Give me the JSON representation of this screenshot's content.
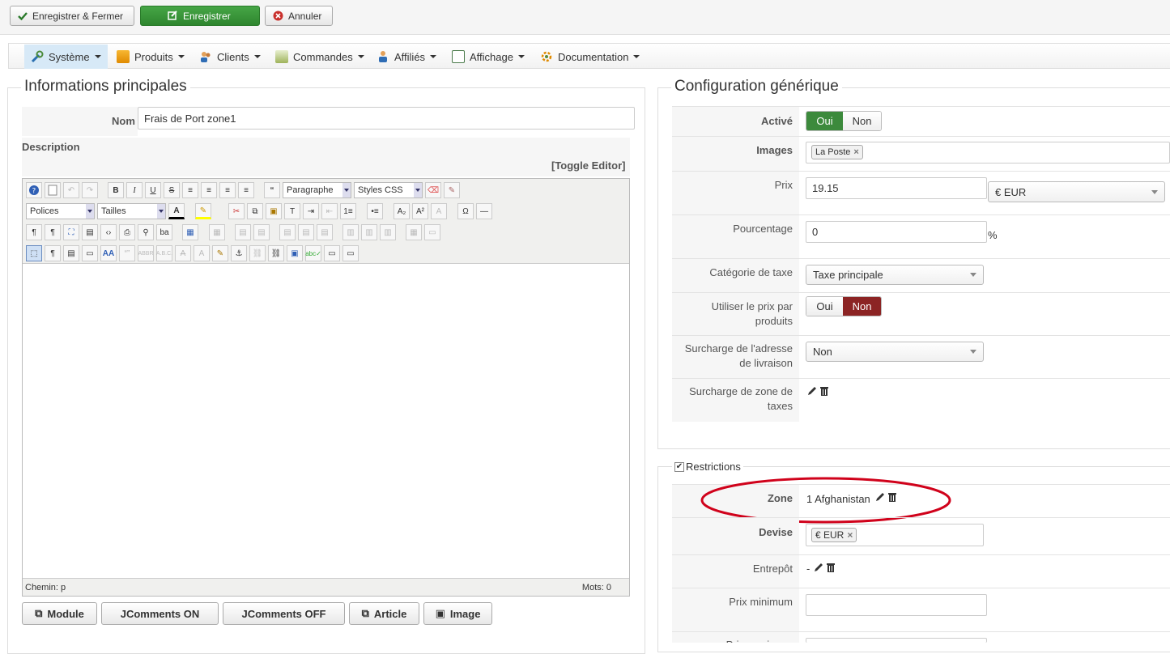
{
  "toolbar": {
    "save_close": "Enregistrer & Fermer",
    "save": "Enregistrer",
    "cancel": "Annuler"
  },
  "menu": {
    "items": [
      {
        "label": "Système",
        "icon": "tools-icon"
      },
      {
        "label": "Produits",
        "icon": "box-icon"
      },
      {
        "label": "Clients",
        "icon": "users-icon"
      },
      {
        "label": "Commandes",
        "icon": "orders-icon"
      },
      {
        "label": "Affiliés",
        "icon": "affiliates-icon"
      },
      {
        "label": "Affichage",
        "icon": "display-icon"
      },
      {
        "label": "Documentation",
        "icon": "documentation-icon"
      }
    ]
  },
  "main_info": {
    "legend": "Informations principales",
    "name_label": "Nom",
    "name_value": "Frais de Port zone1",
    "description_label": "Description",
    "toggle_editor": "[Toggle Editor]",
    "format_select": "Paragraphe",
    "styles_select": "Styles CSS",
    "fonts_select": "Polices",
    "sizes_select": "Tailles",
    "path_label": "Chemin: p",
    "words_label": "Mots: 0",
    "buttons": [
      "Module",
      "JComments ON",
      "JComments OFF",
      "Article",
      "Image"
    ]
  },
  "config": {
    "legend": "Configuration générique",
    "active_label": "Activé",
    "active_yes": "Oui",
    "active_no": "Non",
    "images_label": "Images",
    "images_tag": "La Poste",
    "price_label": "Prix",
    "price_value": "19.15",
    "currency_value": "€ EUR",
    "percent_label": "Pourcentage",
    "percent_value": "0",
    "percent_unit": "%",
    "tax_label": "Catégorie de taxe",
    "tax_value": "Taxe principale",
    "use_price_label": "Utiliser le prix par produits",
    "use_price_yes": "Oui",
    "use_price_no": "Non",
    "override_addr_label": "Surcharge de l'adresse de livraison",
    "override_addr_value": "Non",
    "override_tax_label": "Surcharge de zone de taxes"
  },
  "restrictions": {
    "legend": "Restrictions",
    "zone_label": "Zone",
    "zone_value": "1 Afghanistan",
    "currency_label": "Devise",
    "currency_tag": "€ EUR",
    "warehouse_label": "Entrepôt",
    "warehouse_value": "-",
    "min_price_label": "Prix minimum",
    "max_price_label": "Prix maximum"
  },
  "colors": {
    "green": "#3c8a3c",
    "red": "#8c2424",
    "annotation": "#d0021b"
  }
}
